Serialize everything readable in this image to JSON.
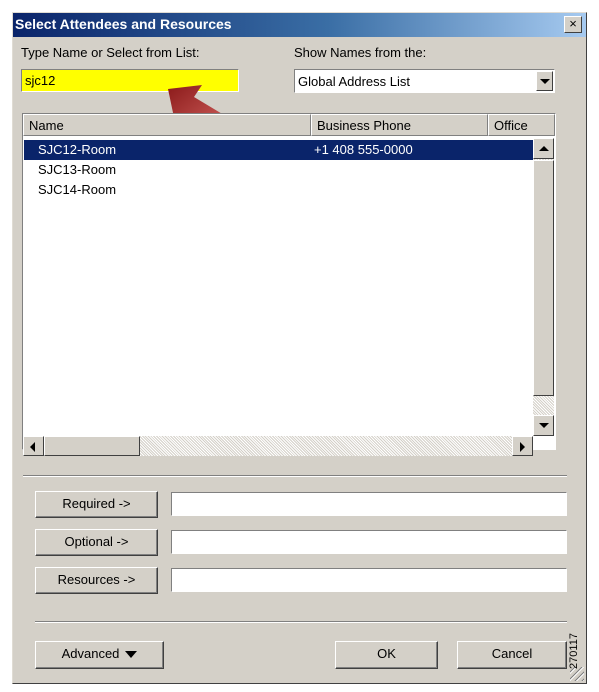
{
  "dialog": {
    "title": "Select Attendees and Resources",
    "close_glyph": "×"
  },
  "search": {
    "label": "Type Name or Select from List:",
    "value": "sjc12"
  },
  "address_book": {
    "label": "Show Names from the:",
    "selected": "Global Address List"
  },
  "list": {
    "columns": [
      "Name",
      "Business Phone",
      "Office"
    ],
    "rows": [
      {
        "name": "SJC12-Room",
        "phone": "+1 408 555-0000",
        "selected": true
      },
      {
        "name": "SJC13-Room",
        "phone": "",
        "selected": false
      },
      {
        "name": "SJC14-Room",
        "phone": "",
        "selected": false
      }
    ]
  },
  "recipients": {
    "required_label": "Required ->",
    "optional_label": "Optional ->",
    "resources_label": "Resources ->",
    "required_value": "",
    "optional_value": "",
    "resources_value": ""
  },
  "footer": {
    "advanced_label": "Advanced",
    "ok_label": "OK",
    "cancel_label": "Cancel"
  },
  "figure_id": "270117",
  "colors": {
    "title_gradient_start": "#0a246a",
    "selection": "#0a246a",
    "search_highlight": "#ffff00",
    "annotation_arrow": "#c0504d"
  },
  "icons": [
    "close-icon",
    "dropdown-arrow-icon",
    "annotation-arrow-icon",
    "scroll-up-icon",
    "scroll-down-icon",
    "scroll-left-icon",
    "scroll-right-icon",
    "resize-grip-icon"
  ]
}
